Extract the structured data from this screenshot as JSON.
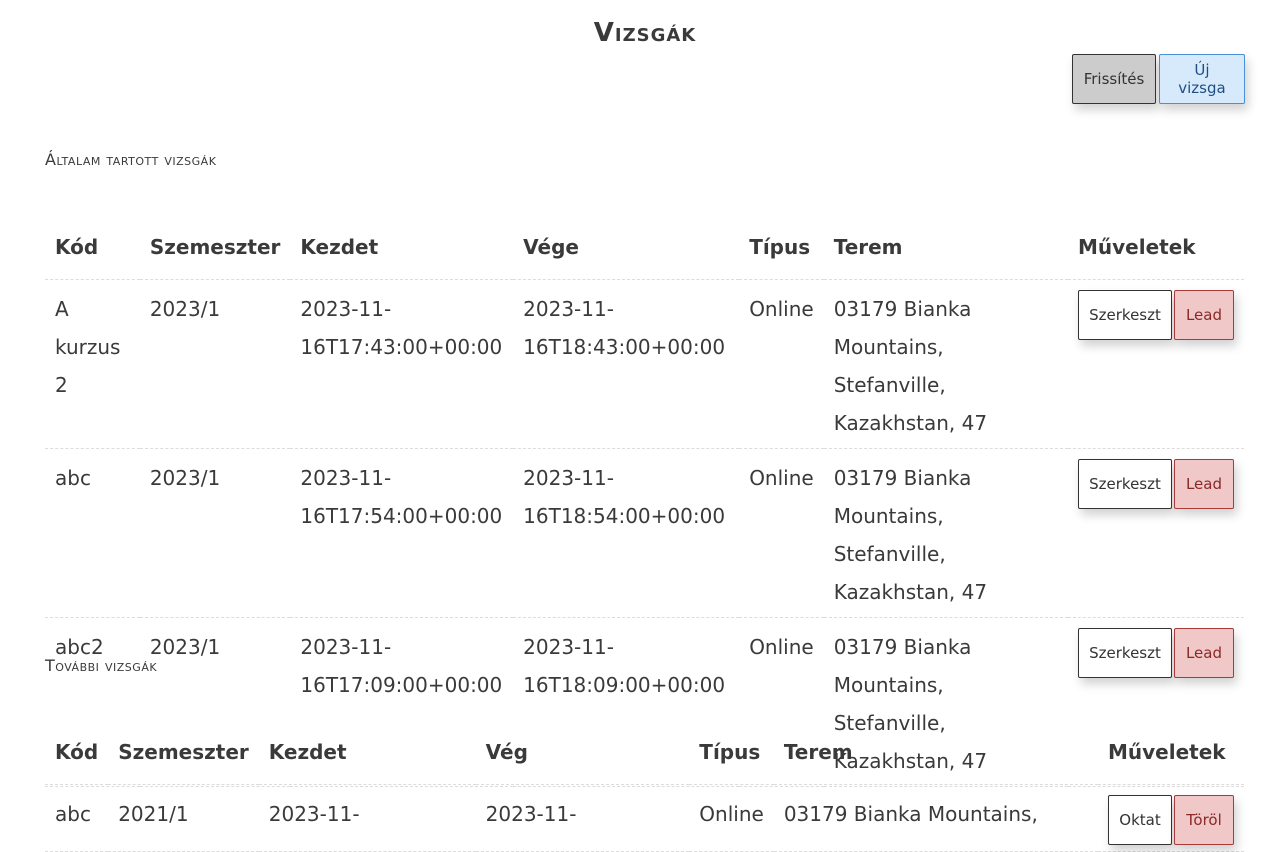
{
  "page": {
    "title": "Vizsgák"
  },
  "toolbar": {
    "refresh_label": "Frissítés",
    "new_exam_label": "Új vizsga"
  },
  "own_exams": {
    "heading": "Általam tartott vizsgák",
    "columns": [
      "Kód",
      "Szemeszter",
      "Kezdet",
      "Vége",
      "Típus",
      "Terem",
      "Műveletek"
    ],
    "rows": [
      {
        "code": "A kurzus 2",
        "semester": "2023/1",
        "start": "2023-11-16T17:43:00+00:00",
        "end": "2023-11-16T18:43:00+00:00",
        "type": "Online",
        "room": "03179 Bianka Mountains, Stefanville, Kazakhstan, 47",
        "edit_label": "Szerkeszt",
        "submit_label": "Lead"
      },
      {
        "code": "abc",
        "semester": "2023/1",
        "start": "2023-11-16T17:54:00+00:00",
        "end": "2023-11-16T18:54:00+00:00",
        "type": "Online",
        "room": "03179 Bianka Mountains, Stefanville, Kazakhstan, 47",
        "edit_label": "Szerkeszt",
        "submit_label": "Lead"
      },
      {
        "code": "abc2",
        "semester": "2023/1",
        "start": "2023-11-16T17:09:00+00:00",
        "end": "2023-11-16T18:09:00+00:00",
        "type": "Online",
        "room": "03179 Bianka Mountains, Stefanville, Kazakhstan, 47",
        "edit_label": "Szerkeszt",
        "submit_label": "Lead"
      }
    ]
  },
  "other_exams": {
    "heading": "További vizsgák",
    "columns": [
      "Kód",
      "Szemeszter",
      "Kezdet",
      "Vég",
      "Típus",
      "Terem",
      "Műveletek"
    ],
    "rows": [
      {
        "code": "abc",
        "semester": "2021/1",
        "start": "2023-11-",
        "end": "2023-11-",
        "type": "Online",
        "room": "03179 Bianka Mountains,",
        "teach_label": "Oktat",
        "delete_label": "Töröl"
      }
    ]
  }
}
